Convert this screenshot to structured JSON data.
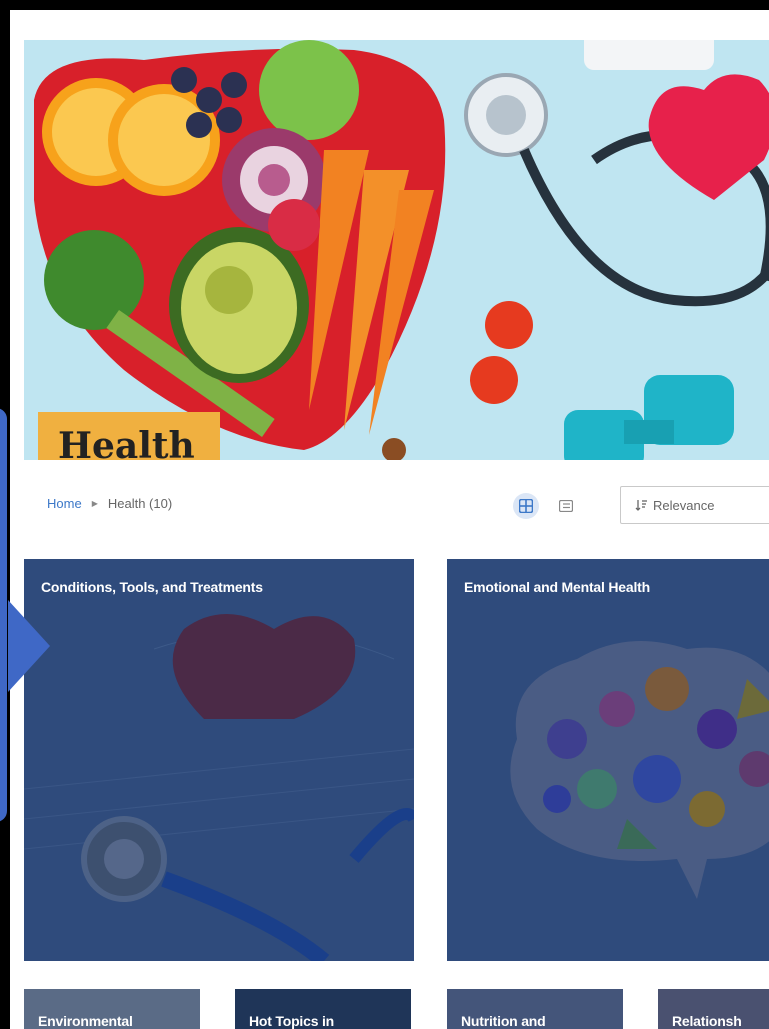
{
  "hero": {
    "title": "Health",
    "image": "fruits-vegetables-stethoscope-heart-dumbbells"
  },
  "breadcrumb": {
    "home": "Home",
    "current": "Health (10)"
  },
  "toolbar": {
    "grid_view_icon": "grid-icon",
    "list_view_icon": "list-icon",
    "sort_icon": "sort-icon",
    "sort_label": "Relevance"
  },
  "cards": [
    {
      "title": "Conditions, Tools, and Treatments",
      "image": "heart-stethoscope-ecg"
    },
    {
      "title": "Emotional and Mental Health",
      "image": "colorful-brain"
    }
  ],
  "small_cards": [
    {
      "title": "Environmental"
    },
    {
      "title": "Hot Topics in"
    },
    {
      "title": "Nutrition and"
    },
    {
      "title": "Relationsh"
    }
  ],
  "colors": {
    "card_overlay": "#2f4b7c",
    "hero_badge": "#f0b040",
    "link": "#3c78c8",
    "callout": "#3f68c6"
  }
}
